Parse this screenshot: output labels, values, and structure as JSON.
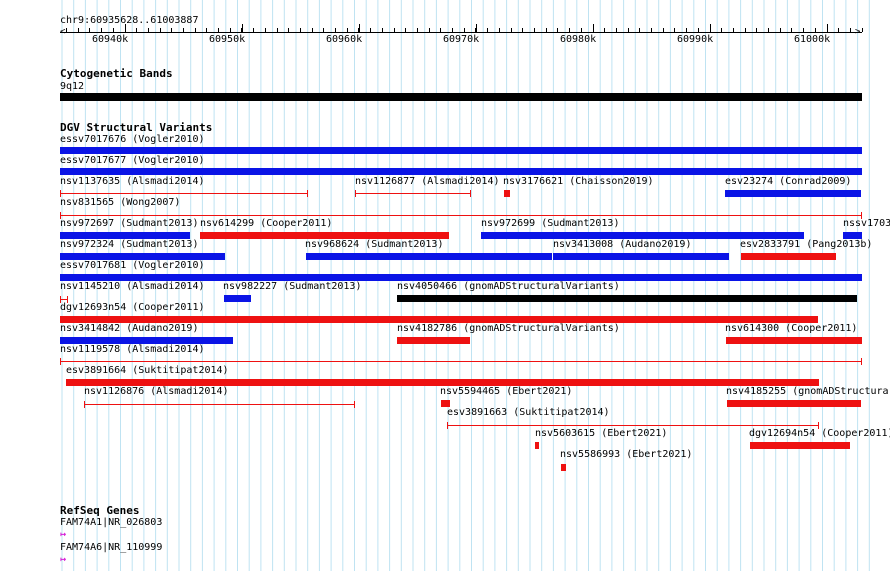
{
  "colors": {
    "gridline": "#bfe3f2",
    "red": "#ee1111",
    "blue": "#0a14e6",
    "black": "#000000",
    "gene": "#d61cd6"
  },
  "ruler": {
    "region": "chr9:60935628..61003887",
    "ticks": [
      "60940k",
      "60950k",
      "60960k",
      "60970k",
      "60980k",
      "60990k",
      "61000k"
    ]
  },
  "cytoband": {
    "title": "Cytogenetic Bands",
    "band": "9q12"
  },
  "dgv": {
    "title": "DGV Structural Variants",
    "features": [
      {
        "label": "essv7017676 (Vogler2010)",
        "color": "blue",
        "style": "bar",
        "row": 0
      },
      {
        "label": "essv7017677 (Vogler2010)",
        "color": "blue",
        "style": "bar",
        "row": 1
      },
      {
        "label": "nsv1137635 (Alsmadi2014)",
        "color": "red",
        "style": "line",
        "row": 2
      },
      {
        "label": "nsv1126877 (Alsmadi2014)",
        "color": "red",
        "style": "line",
        "row": 2
      },
      {
        "label": "nsv3176621 (Chaisson2019)",
        "color": "red",
        "style": "bar",
        "row": 2
      },
      {
        "label": "esv23274 (Conrad2009)",
        "color": "blue",
        "style": "bar",
        "row": 2
      },
      {
        "label": "nsv831565 (Wong2007)",
        "color": "red",
        "style": "line",
        "row": 3
      },
      {
        "label": "nsv972697 (Sudmant2013)",
        "color": "blue",
        "style": "bar",
        "row": 4
      },
      {
        "label": "nsv614299 (Cooper2011)",
        "color": "red",
        "style": "bar",
        "row": 4
      },
      {
        "label": "nsv972699 (Sudmant2013)",
        "color": "blue",
        "style": "bar",
        "row": 4
      },
      {
        "label": "nssv1703",
        "color": "blue",
        "style": "bar",
        "row": 4
      },
      {
        "label": "nsv972324 (Sudmant2013)",
        "color": "blue",
        "style": "bar",
        "row": 5
      },
      {
        "label": "nsv968624 (Sudmant2013)",
        "color": "blue",
        "style": "bar",
        "row": 5
      },
      {
        "label": "nsv3413008 (Audano2019)",
        "color": "blue",
        "style": "bar",
        "row": 5
      },
      {
        "label": "esv2833791 (Pang2013b)",
        "color": "red",
        "style": "bar",
        "row": 5
      },
      {
        "label": "essv7017681 (Vogler2010)",
        "color": "blue",
        "style": "bar",
        "row": 6
      },
      {
        "label": "nsv1145210 (Alsmadi2014)",
        "color": "red",
        "style": "line",
        "row": 7
      },
      {
        "label": "nsv982227 (Sudmant2013)",
        "color": "blue",
        "style": "bar",
        "row": 7
      },
      {
        "label": "nsv4050466 (gnomADStructuralVariants)",
        "color": "black",
        "style": "bar",
        "row": 7
      },
      {
        "label": "dgv12693n54 (Cooper2011)",
        "color": "red",
        "style": "bar",
        "row": 8
      },
      {
        "label": "nsv3414842 (Audano2019)",
        "color": "blue",
        "style": "bar",
        "row": 9
      },
      {
        "label": "nsv4182786 (gnomADStructuralVariants)",
        "color": "red",
        "style": "bar",
        "row": 9
      },
      {
        "label": "nsv614300 (Cooper2011)",
        "color": "red",
        "style": "bar",
        "row": 9
      },
      {
        "label": "nsv1119578 (Alsmadi2014)",
        "color": "red",
        "style": "line",
        "row": 10
      },
      {
        "label": "esv3891664 (Suktitipat2014)",
        "color": "red",
        "style": "bar",
        "row": 11
      },
      {
        "label": "nsv1126876 (Alsmadi2014)",
        "color": "red",
        "style": "line",
        "row": 12
      },
      {
        "label": "nsv5594465 (Ebert2021)",
        "color": "red",
        "style": "bar",
        "row": 12
      },
      {
        "label": "nsv4185255 (gnomADStructura",
        "color": "red",
        "style": "bar",
        "row": 12
      },
      {
        "label": "esv3891663 (Suktitipat2014)",
        "color": "red",
        "style": "line",
        "row": 13
      },
      {
        "label": "nsv5603615 (Ebert2021)",
        "color": "red",
        "style": "bar",
        "row": 14
      },
      {
        "label": "dgv12694n54 (Cooper2011)",
        "color": "red",
        "style": "bar",
        "row": 14
      },
      {
        "label": "nsv5586993 (Ebert2021)",
        "color": "red",
        "style": "bar",
        "row": 15
      }
    ]
  },
  "refseq": {
    "title": "RefSeq Genes",
    "genes": [
      {
        "label": "FAM74A1|NR_026803",
        "icon": "gene-strand-arrow-icon"
      },
      {
        "label": "FAM74A6|NR_110999",
        "icon": "gene-strand-arrow-icon"
      }
    ]
  }
}
